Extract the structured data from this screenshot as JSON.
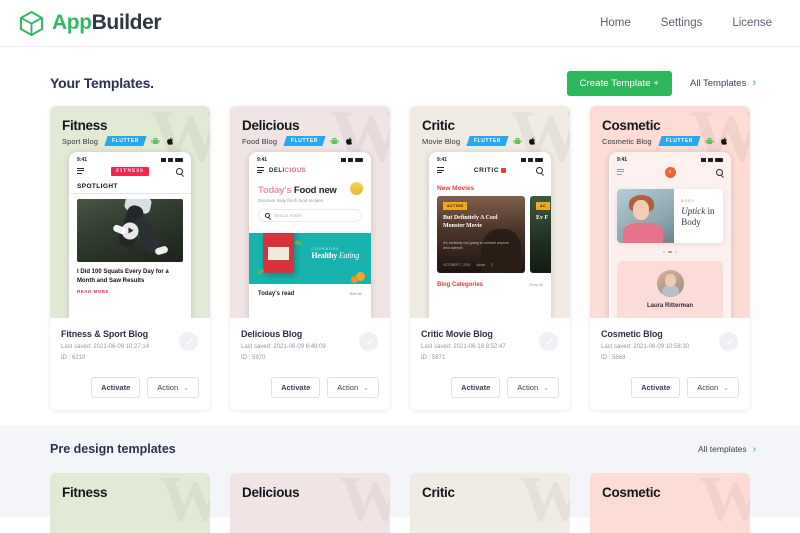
{
  "brand": {
    "part1": "App",
    "part2": "Builder",
    "logo_icon": "hexagon-cube-icon"
  },
  "nav": {
    "items": [
      {
        "label": "Home"
      },
      {
        "label": "Settings"
      },
      {
        "label": "License"
      }
    ]
  },
  "your_templates": {
    "title": "Your Templates.",
    "create_button": "Create Template +",
    "all_link": "All Templates",
    "chevron": "›"
  },
  "pre_design": {
    "title": "Pre design templates",
    "all_link": "All templates",
    "chevron": "›"
  },
  "cards": [
    {
      "preview": {
        "name": "Fitness",
        "sub": "Sport Blog",
        "badge": "FLUTTER",
        "bg": "#e2ead5",
        "watermark": "W"
      },
      "phone": {
        "time": "9:41",
        "logo": "FITNESS",
        "heading": "SPOTLIGHT",
        "article_title": "I Did 100 Squats Every Day for a Month and Saw Results",
        "read_more": "READ MORE"
      },
      "title": "Fitness & Sport Blog",
      "saved": "Last saved: 2021-06-09 10:27:14",
      "id": "ID : 6210",
      "activate": "Activate",
      "action": "Action",
      "caret": "⌄"
    },
    {
      "preview": {
        "name": "Delicious",
        "sub": "Food Blog",
        "badge": "FLUTTER",
        "bg": "#f1e4e4",
        "watermark": "W"
      },
      "phone": {
        "time": "9:41",
        "logo_pink": "DELI",
        "logo_dark": "CIOUS",
        "title_pink": "Today's",
        "title_dark": "Food new",
        "subtitle": "Discover daily fresh food recipes.",
        "search_placeholder": "Search Article",
        "banner_label": "COOKBOOK",
        "banner_title": "Healthy",
        "banner_title_em": "Eating",
        "section": "Today's read",
        "see_all": "See All"
      },
      "title": "Delicious Blog",
      "saved": "Last saved: 2021-06-09 6:49:09",
      "id": "ID : 5970",
      "activate": "Activate",
      "action": "Action",
      "caret": "⌄"
    },
    {
      "preview": {
        "name": "Critic",
        "sub": "Movie Blog",
        "badge": "FLUTTER",
        "bg": "#f0ece3",
        "watermark": "W"
      },
      "phone": {
        "time": "9:41",
        "logo": "CRITIC",
        "heading": "New Movies",
        "tag": "ACTION",
        "movie_title": "But Definitely A Cool Monster Movie",
        "movie_desc": "It's certainly not going to convert anyone who doesn't.",
        "movie_date": "OCTOBER 7, 2019",
        "movie_author": "Admin",
        "movie_comments": "3",
        "tag2": "AC",
        "movie2_title": "Ev F",
        "categories": "Blog Categories",
        "show_all": "Show All"
      },
      "title": "Critic Movie Blog",
      "saved": "Last saved: 2021-06-18 8:52:47",
      "id": "ID : 5871",
      "activate": "Activate",
      "action": "Action",
      "caret": "⌄"
    },
    {
      "preview": {
        "name": "Cosmetic",
        "sub": "Cosmetic Blog",
        "badge": "FLUTTER",
        "bg": "#fcdcd5",
        "watermark": "W"
      },
      "phone": {
        "time": "9:41",
        "logo": "ô",
        "label": "BODY",
        "title_italic": "Uptick",
        "title_rest": "in Body",
        "author": "Laura Ritterman"
      },
      "title": "Cosmetic Blog",
      "saved": "Last saved: 2021-06-09 10:58:30",
      "id": "ID : 5668",
      "activate": "Activate",
      "action": "Action",
      "caret": "⌄"
    }
  ],
  "pre_cards": [
    {
      "name": "Fitness",
      "bg": "#e2ead5"
    },
    {
      "name": "Delicious",
      "bg": "#f1e4e4"
    },
    {
      "name": "Critic",
      "bg": "#f0ece3"
    },
    {
      "name": "Cosmetic",
      "bg": "#fcdcd5"
    }
  ],
  "colors": {
    "brand_green": "#34b865",
    "accent_green": "#2eb85c",
    "flutter_blue": "#28a8f0",
    "page_alt_bg": "#f4f5f9"
  }
}
